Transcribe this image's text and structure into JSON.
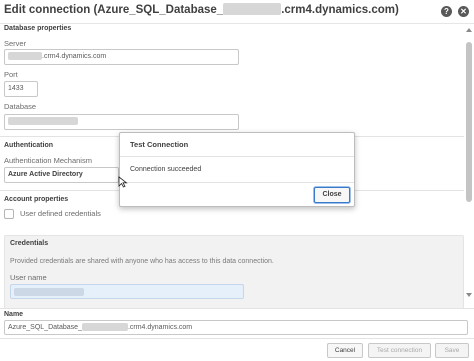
{
  "header": {
    "title_prefix": "Edit connection (Azure_SQL_Database_",
    "title_suffix": ".crm4.dynamics.com)",
    "help_icon": "help-icon",
    "close_icon": "close-icon"
  },
  "database_properties": {
    "section_title": "Database properties",
    "server_label": "Server",
    "server_value_suffix": ".crm4.dynamics.com",
    "port_label": "Port",
    "port_value": "1433",
    "database_label": "Database"
  },
  "authentication": {
    "section_title": "Authentication",
    "mechanism_label": "Authentication Mechanism",
    "mechanism_value": "Azure Active Directory"
  },
  "account_properties": {
    "section_title": "Account properties",
    "checkbox_label": "User defined credentials"
  },
  "credentials": {
    "title": "Credentials",
    "description": "Provided credentials are shared with anyone who has access to this data connection.",
    "username_label": "User name"
  },
  "name": {
    "label": "Name",
    "value_prefix": "Azure_SQL_Database_",
    "value_suffix": ".crm4.dynamics.com"
  },
  "footer": {
    "cancel": "Cancel",
    "test": "Test connection",
    "save": "Save"
  },
  "dialog": {
    "title": "Test Connection",
    "message": "Connection succeeded",
    "close": "Close"
  },
  "colors": {
    "accent": "#3a78c9",
    "text": "#404040",
    "highlight_field": "#e6f0fb"
  }
}
